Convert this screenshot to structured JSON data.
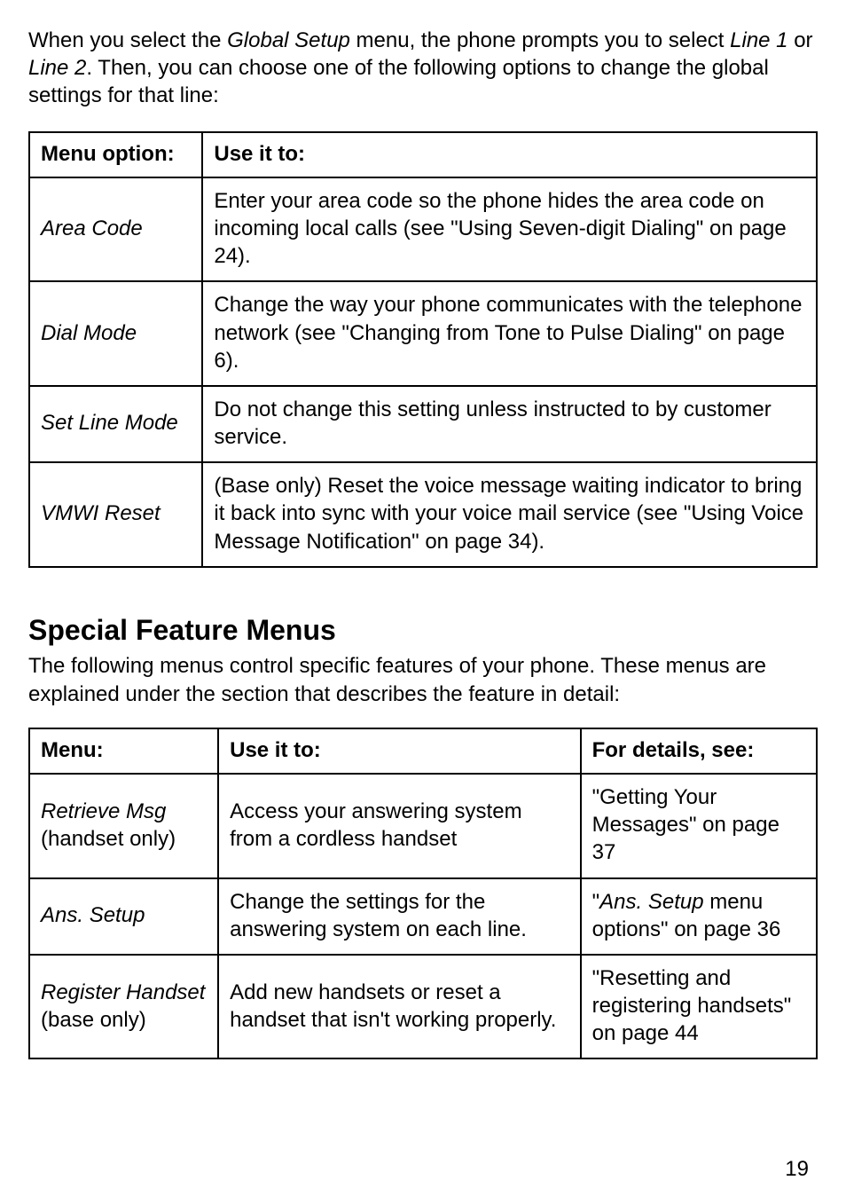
{
  "intro": {
    "prefix": "When you select the ",
    "globalSetup": "Global Setup",
    "mid1": " menu, the phone prompts you to select ",
    "line1": "Line 1",
    "or": " or ",
    "line2": "Line 2",
    "suffix": ". Then, you can choose one of the following options to change the global settings for that line:"
  },
  "table1": {
    "headers": {
      "col0": "Menu option:",
      "col1": "Use it to:"
    },
    "rows": [
      {
        "name": "Area Code",
        "desc": "Enter your area code so the phone hides the area code on incoming local calls (see \"Using Seven-digit Dialing\" on page 24)."
      },
      {
        "name": "Dial Mode",
        "desc": "Change the way your phone communicates with the telephone network (see \"Changing from Tone to Pulse Dialing\" on page 6)."
      },
      {
        "name": "Set Line Mode",
        "desc": "Do not change this setting unless instructed to by customer service."
      },
      {
        "name": "VMWI Reset",
        "desc": "(Base only) Reset the voice message waiting indicator to bring it back into sync with your voice mail service (see \"Using Voice Message Notification\" on page 34)."
      }
    ]
  },
  "section": {
    "title": "Special Feature Menus",
    "intro": "The following menus control specific features of your phone. These menus are explained under the section that describes the feature in detail:"
  },
  "table2": {
    "headers": {
      "col0": "Menu:",
      "col1": "Use it to:",
      "col2": "For details, see:"
    },
    "rows": [
      {
        "nameItalic": "Retrieve Msg",
        "nameNote": " (handset only)",
        "desc": "Access your answering system from a cordless handset",
        "detail": "\"Getting Your Messages\" on page 37"
      },
      {
        "nameItalic": "Ans. Setup",
        "nameNote": "",
        "desc": "Change the settings for the answering system on each line.",
        "detailPrefix": "\"",
        "detailItalic": "Ans. Setup",
        "detailSuffix": " menu options\" on page 36"
      },
      {
        "nameItalic": "Register Handset",
        "nameNote": " (base only)",
        "desc": "Add new handsets or reset a handset that isn't working properly.",
        "detail": "\"Resetting and registering handsets\" on page 44"
      }
    ]
  },
  "pageNumber": "19"
}
